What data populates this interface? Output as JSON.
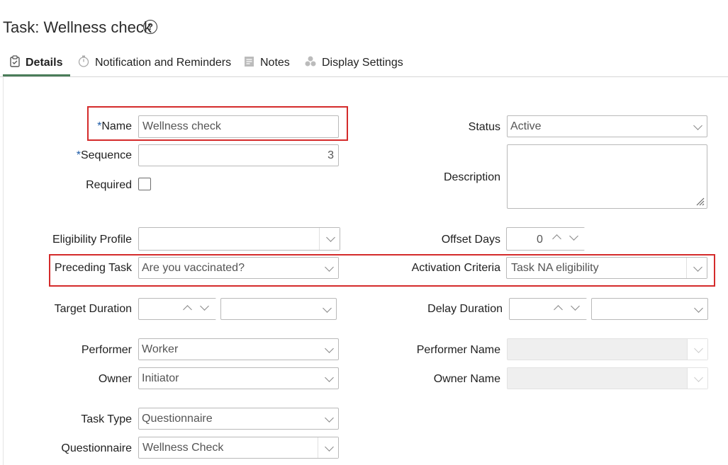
{
  "page": {
    "title": "Task: Wellness check",
    "help_icon": "question-circle-icon"
  },
  "tabs": [
    {
      "label": "Details",
      "icon": "clipboard-icon",
      "active": true
    },
    {
      "label": "Notification and Reminders",
      "icon": "stopwatch-icon"
    },
    {
      "label": "Notes",
      "icon": "note-icon"
    },
    {
      "label": "Display Settings",
      "icon": "shapes-icon"
    }
  ],
  "form": {
    "name": {
      "label": "Name",
      "required_mark": "*",
      "value": "Wellness check"
    },
    "sequence": {
      "label": "Sequence",
      "required_mark": "*",
      "value": "3"
    },
    "required": {
      "label": "Required",
      "checked": false
    },
    "eligibility_profile": {
      "label": "Eligibility Profile",
      "value": ""
    },
    "preceding_task": {
      "label": "Preceding Task",
      "value": "Are you vaccinated?"
    },
    "target_duration": {
      "label": "Target Duration",
      "value": "",
      "unit": ""
    },
    "performer": {
      "label": "Performer",
      "value": "Worker"
    },
    "owner": {
      "label": "Owner",
      "value": "Initiator"
    },
    "task_type": {
      "label": "Task Type",
      "value": "Questionnaire"
    },
    "questionnaire": {
      "label": "Questionnaire",
      "value": "Wellness Check"
    },
    "status": {
      "label": "Status",
      "value": "Active"
    },
    "description": {
      "label": "Description",
      "value": ""
    },
    "offset_days": {
      "label": "Offset Days",
      "value": "0"
    },
    "activation_criteria": {
      "label": "Activation Criteria",
      "value": "Task NA eligibility"
    },
    "delay_duration": {
      "label": "Delay Duration",
      "value": "",
      "unit": ""
    },
    "performer_name": {
      "label": "Performer Name",
      "value": ""
    },
    "owner_name": {
      "label": "Owner Name",
      "value": ""
    }
  },
  "colors": {
    "highlight": "#d42b2b",
    "tab_active": "#4a7c59",
    "required": "#1f5da8"
  }
}
